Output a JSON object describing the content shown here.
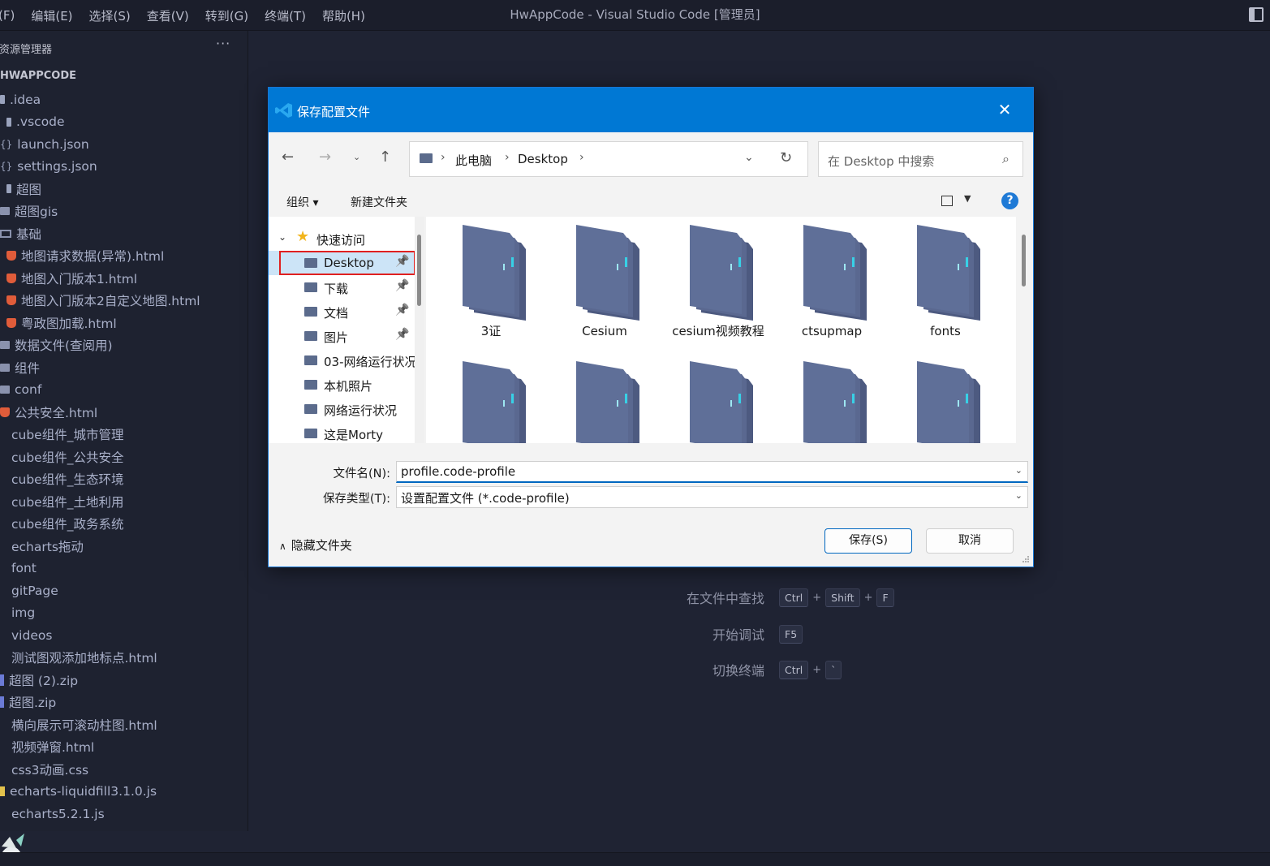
{
  "vscode": {
    "menu": [
      "(F)",
      "编辑(E)",
      "选择(S)",
      "查看(V)",
      "转到(G)",
      "终端(T)",
      "帮助(H)"
    ],
    "window_title": "HwAppCode - Visual Studio Code [管理员]",
    "explorer_title": "资源管理器",
    "explorer_more": "···",
    "section_title": "HWAPPCODE",
    "tree": [
      {
        "label": ".idea",
        "icon": "file",
        "indent": 0
      },
      {
        "label": ".vscode",
        "icon": "file",
        "indent": 8
      },
      {
        "label": "launch.json",
        "icon": "json",
        "indent": 0
      },
      {
        "label": "settings.json",
        "icon": "json",
        "indent": 0
      },
      {
        "label": "超图",
        "icon": "file",
        "indent": 8
      },
      {
        "label": "超图gis",
        "icon": "folder",
        "indent": 0
      },
      {
        "label": "基础",
        "icon": "folder-open",
        "indent": 0
      },
      {
        "label": "地图请求数据(异常).html",
        "icon": "html",
        "indent": 8
      },
      {
        "label": "地图入门版本1.html",
        "icon": "html",
        "indent": 8
      },
      {
        "label": "地图入门版本2自定义地图.html",
        "icon": "html",
        "indent": 8
      },
      {
        "label": "粤政图加载.html",
        "icon": "html",
        "indent": 8
      },
      {
        "label": "数据文件(查阅用)",
        "icon": "folder",
        "indent": 0
      },
      {
        "label": "组件",
        "icon": "folder",
        "indent": 0
      },
      {
        "label": "conf",
        "icon": "folder",
        "indent": 0
      },
      {
        "label": "公共安全.html",
        "icon": "html",
        "indent": 0
      },
      {
        "label": "cube组件_城市管理",
        "icon": "none",
        "indent": 14
      },
      {
        "label": "cube组件_公共安全",
        "icon": "none",
        "indent": 14
      },
      {
        "label": "cube组件_生态环境",
        "icon": "none",
        "indent": 14
      },
      {
        "label": "cube组件_土地利用",
        "icon": "none",
        "indent": 14
      },
      {
        "label": "cube组件_政务系统",
        "icon": "none",
        "indent": 14
      },
      {
        "label": "echarts拖动",
        "icon": "none",
        "indent": 14
      },
      {
        "label": "font",
        "icon": "none",
        "indent": 14
      },
      {
        "label": "gitPage",
        "icon": "none",
        "indent": 14
      },
      {
        "label": "img",
        "icon": "none",
        "indent": 14
      },
      {
        "label": "videos",
        "icon": "none",
        "indent": 14
      },
      {
        "label": "测试图观添加地标点.html",
        "icon": "none",
        "indent": 14
      },
      {
        "label": "超图 (2).zip",
        "icon": "zip",
        "indent": 0
      },
      {
        "label": "超图.zip",
        "icon": "zip",
        "indent": 0
      },
      {
        "label": "横向展示可滚动柱图.html",
        "icon": "none",
        "indent": 14
      },
      {
        "label": "视频弹窗.html",
        "icon": "none",
        "indent": 14
      },
      {
        "label": "css3动画.css",
        "icon": "none",
        "indent": 14
      },
      {
        "label": "echarts-liquidfill3.1.0.js",
        "icon": "js",
        "indent": 0
      },
      {
        "label": "echarts5.2.1.js",
        "icon": "none",
        "indent": 14
      }
    ],
    "shortcuts": [
      {
        "label": "在文件中查找",
        "keys": [
          "Ctrl",
          "Shift",
          "F"
        ]
      },
      {
        "label": "开始调试",
        "keys": [
          "F5"
        ]
      },
      {
        "label": "切换终端",
        "keys": [
          "Ctrl",
          "`"
        ]
      }
    ]
  },
  "dialog": {
    "title": "保存配置文件",
    "close_icon": "close-icon",
    "address": {
      "part1": "此电脑",
      "part2": "Desktop"
    },
    "search_placeholder": "在 Desktop 中搜索",
    "toolbar": {
      "organize": "组织 ▾",
      "new_folder": "新建文件夹",
      "help": "?"
    },
    "nav": {
      "quick_access": "快速访问",
      "items": [
        {
          "label": "Desktop",
          "pinned": true
        },
        {
          "label": "下载",
          "pinned": true
        },
        {
          "label": "文档",
          "pinned": true
        },
        {
          "label": "图片",
          "pinned": true
        },
        {
          "label": "03-网络运行状况",
          "pinned": false
        },
        {
          "label": "本机照片",
          "pinned": false
        },
        {
          "label": "网络运行状况",
          "pinned": false
        },
        {
          "label": "这是Morty",
          "pinned": false
        }
      ]
    },
    "folders": [
      {
        "label": "3证"
      },
      {
        "label": "Cesium"
      },
      {
        "label": "cesium视频教程"
      },
      {
        "label": "ctsupmap"
      },
      {
        "label": "fonts"
      },
      {
        "label": ""
      },
      {
        "label": ""
      },
      {
        "label": ""
      },
      {
        "label": ""
      },
      {
        "label": ""
      }
    ],
    "filename_label": "文件名(N):",
    "filename_value": "profile.code-profile",
    "filetype_label": "保存类型(T):",
    "filetype_value": "设置配置文件 (*.code-profile)",
    "hide_folders": "隐藏文件夹",
    "save_button": "保存(S)",
    "cancel_button": "取消",
    "colors": {
      "titlebar": "#0078d4",
      "folder": "#5f6f98",
      "accent": "#0067c0",
      "highlight": "#e02020"
    }
  }
}
